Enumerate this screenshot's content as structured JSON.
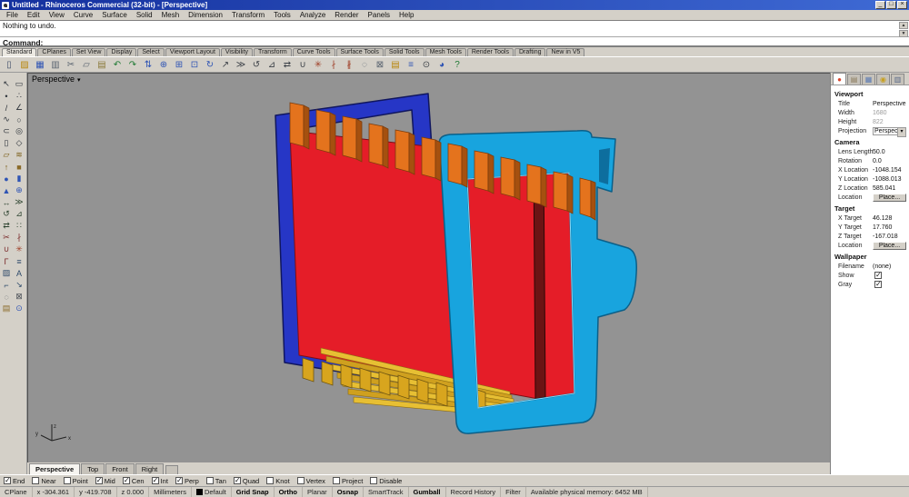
{
  "window": {
    "title": "Untitled - Rhinoceros Commercial (32-bit) - [Perspective]"
  },
  "menu": [
    "File",
    "Edit",
    "View",
    "Curve",
    "Surface",
    "Solid",
    "Mesh",
    "Dimension",
    "Transform",
    "Tools",
    "Analyze",
    "Render",
    "Panels",
    "Help"
  ],
  "command": {
    "history_line": "Nothing to undo.",
    "prompt": "Command:"
  },
  "toolbar_tabs": [
    {
      "label": "Standard",
      "active": true
    },
    {
      "label": "CPlanes"
    },
    {
      "label": "Set View"
    },
    {
      "label": "Display"
    },
    {
      "label": "Select"
    },
    {
      "label": "Viewport Layout"
    },
    {
      "label": "Visibility"
    },
    {
      "label": "Transform"
    },
    {
      "label": "Curve Tools"
    },
    {
      "label": "Surface Tools"
    },
    {
      "label": "Solid Tools"
    },
    {
      "label": "Mesh Tools"
    },
    {
      "label": "Render Tools"
    },
    {
      "label": "Drafting"
    },
    {
      "label": "New in V5"
    }
  ],
  "toolbar_icons": [
    {
      "name": "new-file-icon",
      "glyph": "▯",
      "color": "#3c4a66"
    },
    {
      "name": "open-file-icon",
      "glyph": "▨",
      "color": "#b8860b"
    },
    {
      "name": "save-file-icon",
      "glyph": "▦",
      "color": "#2f54b4"
    },
    {
      "name": "print-icon",
      "glyph": "▥",
      "color": "#5a6470"
    },
    {
      "name": "cut-icon",
      "glyph": "✂",
      "color": "#5a6470"
    },
    {
      "name": "copy-icon",
      "glyph": "▱",
      "color": "#5a6470"
    },
    {
      "name": "paste-icon",
      "glyph": "▤",
      "color": "#8a7a3a"
    },
    {
      "name": "undo-icon",
      "glyph": "↶",
      "color": "#1f7a34"
    },
    {
      "name": "redo-icon",
      "glyph": "↷",
      "color": "#1f7a34"
    },
    {
      "name": "pan-view-icon",
      "glyph": "⇅",
      "color": "#2f54b4"
    },
    {
      "name": "zoom-dynamic-icon",
      "glyph": "⊕",
      "color": "#2f54b4"
    },
    {
      "name": "zoom-window-icon",
      "glyph": "⊞",
      "color": "#2f54b4"
    },
    {
      "name": "zoom-extents-icon",
      "glyph": "⊡",
      "color": "#2f54b4"
    },
    {
      "name": "rotate-view-icon",
      "glyph": "↻",
      "color": "#2f54b4"
    },
    {
      "name": "move-icon",
      "glyph": "↗",
      "color": "#3a3f46"
    },
    {
      "name": "copy-object-icon",
      "glyph": "≫",
      "color": "#3a3f46"
    },
    {
      "name": "rotate-icon",
      "glyph": "↺",
      "color": "#3a3f46"
    },
    {
      "name": "scale-icon",
      "glyph": "⊿",
      "color": "#3a3f46"
    },
    {
      "name": "mirror-icon",
      "glyph": "⇄",
      "color": "#3a3f46"
    },
    {
      "name": "join-icon",
      "glyph": "∪",
      "color": "#3a3f46"
    },
    {
      "name": "explode-icon",
      "glyph": "✳",
      "color": "#a04028"
    },
    {
      "name": "trim-icon",
      "glyph": "∤",
      "color": "#a04028"
    },
    {
      "name": "split-icon",
      "glyph": "∦",
      "color": "#a04028"
    },
    {
      "name": "hide-icon",
      "glyph": "◌",
      "color": "#5a6470"
    },
    {
      "name": "lock-icon",
      "glyph": "⊠",
      "color": "#5a6470"
    },
    {
      "name": "layers-icon",
      "glyph": "▤",
      "color": "#b8860b"
    },
    {
      "name": "properties-icon",
      "glyph": "≡",
      "color": "#2f54b4"
    },
    {
      "name": "osnap-icon",
      "glyph": "⊙",
      "color": "#3a3f46"
    },
    {
      "name": "render-icon",
      "glyph": "◕",
      "color": "#2f54b4"
    },
    {
      "name": "help-icon",
      "glyph": "?",
      "color": "#1f7a34"
    }
  ],
  "sidebar_icons": [
    {
      "name": "select-icon",
      "glyph": "↖",
      "color": "#2b3138"
    },
    {
      "name": "select-lasso-icon",
      "glyph": "▭",
      "color": "#2b3138"
    },
    {
      "name": "point-icon",
      "glyph": "•",
      "color": "#2b3138"
    },
    {
      "name": "multi-point-icon",
      "glyph": "∴",
      "color": "#2b3138"
    },
    {
      "name": "line-icon",
      "glyph": "/",
      "color": "#2b3138"
    },
    {
      "name": "polyline-icon",
      "glyph": "∠",
      "color": "#2b3138"
    },
    {
      "name": "curve-icon",
      "glyph": "∿",
      "color": "#2b3138"
    },
    {
      "name": "circle-icon",
      "glyph": "○",
      "color": "#2b3138"
    },
    {
      "name": "arc-icon",
      "glyph": "⊂",
      "color": "#2b3138"
    },
    {
      "name": "ellipse-icon",
      "glyph": "◎",
      "color": "#2b3138"
    },
    {
      "name": "rectangle-icon",
      "glyph": "▯",
      "color": "#2b3138"
    },
    {
      "name": "polygon-icon",
      "glyph": "◇",
      "color": "#2b3138"
    },
    {
      "name": "surface-icon",
      "glyph": "▱",
      "color": "#7a5c16"
    },
    {
      "name": "loft-icon",
      "glyph": "≋",
      "color": "#7a5c16"
    },
    {
      "name": "extrude-icon",
      "glyph": "↑",
      "color": "#7a5c16"
    },
    {
      "name": "box-icon",
      "glyph": "■",
      "color": "#8a6a28"
    },
    {
      "name": "sphere-icon",
      "glyph": "●",
      "color": "#2f54b4"
    },
    {
      "name": "cylinder-icon",
      "glyph": "▮",
      "color": "#2f54b4"
    },
    {
      "name": "cone-icon",
      "glyph": "▲",
      "color": "#2f54b4"
    },
    {
      "name": "boolean-union-icon",
      "glyph": "⊕",
      "color": "#2f54b4"
    },
    {
      "name": "move-icon",
      "glyph": "↔",
      "color": "#2e4430"
    },
    {
      "name": "copy-icon",
      "glyph": "≫",
      "color": "#2e4430"
    },
    {
      "name": "rotate-icon",
      "glyph": "↺",
      "color": "#2e4430"
    },
    {
      "name": "scale-icon",
      "glyph": "⊿",
      "color": "#2e4430"
    },
    {
      "name": "mirror-icon",
      "glyph": "⇄",
      "color": "#2e4430"
    },
    {
      "name": "array-icon",
      "glyph": "∷",
      "color": "#2e4430"
    },
    {
      "name": "trim-icon",
      "glyph": "✂",
      "color": "#7a2a2a"
    },
    {
      "name": "split-icon",
      "glyph": "∤",
      "color": "#7a2a2a"
    },
    {
      "name": "join-icon",
      "glyph": "∪",
      "color": "#7a2a2a"
    },
    {
      "name": "explode-icon",
      "glyph": "✳",
      "color": "#a04028"
    },
    {
      "name": "fillet-icon",
      "glyph": "Γ",
      "color": "#7a2a2a"
    },
    {
      "name": "offset-icon",
      "glyph": "≡",
      "color": "#2e4a6a"
    },
    {
      "name": "hatch-icon",
      "glyph": "▨",
      "color": "#2e4a6a"
    },
    {
      "name": "text-icon",
      "glyph": "A",
      "color": "#2e4a6a"
    },
    {
      "name": "dimension-icon",
      "glyph": "⌐",
      "color": "#2e4a6a"
    },
    {
      "name": "leader-icon",
      "glyph": "↘",
      "color": "#2e4a6a"
    },
    {
      "name": "hide-object-icon",
      "glyph": "◌",
      "color": "#4a4f56"
    },
    {
      "name": "lock-object-icon",
      "glyph": "⊠",
      "color": "#4a4f56"
    },
    {
      "name": "layer-icon",
      "glyph": "▤",
      "color": "#8a6a28"
    },
    {
      "name": "zoom-target-icon",
      "glyph": "⊙",
      "color": "#2f54b4"
    }
  ],
  "viewport": {
    "label": "Perspective"
  },
  "viewport_tabs": [
    {
      "label": "Perspective",
      "active": true
    },
    {
      "label": "Top"
    },
    {
      "label": "Front"
    },
    {
      "label": "Right"
    }
  ],
  "properties_panel": {
    "tabs": [
      {
        "name": "tab-properties",
        "glyph": "●",
        "color": "#d9442c",
        "active": true
      },
      {
        "name": "tab-layers",
        "glyph": "▤",
        "color": "#8a7a5a"
      },
      {
        "name": "tab-display",
        "glyph": "▦",
        "color": "#5a7ab4"
      },
      {
        "name": "tab-lights",
        "glyph": "◉",
        "color": "#c8a020"
      },
      {
        "name": "tab-help",
        "glyph": "▥",
        "color": "#5a6a8a"
      }
    ],
    "sections": [
      {
        "title": "Viewport",
        "rows": [
          {
            "label": "Title",
            "value": "Perspective"
          },
          {
            "label": "Width",
            "value": "1680",
            "muted": true
          },
          {
            "label": "Height",
            "value": "822",
            "muted": true
          },
          {
            "label": "Projection",
            "value": "Perspect...",
            "dropdown": true
          }
        ]
      },
      {
        "title": "Camera",
        "rows": [
          {
            "label": "Lens Length",
            "value": "50.0"
          },
          {
            "label": "Rotation",
            "value": "0.0"
          },
          {
            "label": "X Location",
            "value": "-1048.154"
          },
          {
            "label": "Y Location",
            "value": "-1088.013"
          },
          {
            "label": "Z Location",
            "value": "585.041"
          },
          {
            "label": "Location",
            "value": "Place...",
            "button": true
          }
        ]
      },
      {
        "title": "Target",
        "rows": [
          {
            "label": "X Target",
            "value": "46.128"
          },
          {
            "label": "Y Target",
            "value": "17.760"
          },
          {
            "label": "Z Target",
            "value": "-167.018"
          },
          {
            "label": "Location",
            "value": "Place...",
            "button": true
          }
        ]
      },
      {
        "title": "Wallpaper",
        "rows": [
          {
            "label": "Filename",
            "value": "(none)"
          },
          {
            "label": "Show",
            "check": true,
            "checked": true
          },
          {
            "label": "Gray",
            "check": true,
            "checked": true
          }
        ]
      }
    ]
  },
  "osnap": {
    "items": [
      {
        "label": "End",
        "checked": true
      },
      {
        "label": "Near"
      },
      {
        "label": "Point"
      },
      {
        "label": "Mid",
        "checked": true
      },
      {
        "label": "Cen",
        "checked": true
      },
      {
        "label": "Int",
        "checked": true
      },
      {
        "label": "Perp",
        "checked": true
      },
      {
        "label": "Tan"
      },
      {
        "label": "Quad",
        "checked": true
      },
      {
        "label": "Knot"
      },
      {
        "label": "Vertex"
      },
      {
        "label": "Project"
      },
      {
        "label": "Disable"
      }
    ]
  },
  "statusbar": {
    "items": [
      {
        "label": "CPlane",
        "click": true
      },
      {
        "label": "x -304.361"
      },
      {
        "label": "y -419.708"
      },
      {
        "label": "z 0.000"
      },
      {
        "label": "Millimeters",
        "click": true
      },
      {
        "label": "Default",
        "swatch": true,
        "click": true
      },
      {
        "label": "Grid Snap",
        "bold": true,
        "click": true
      },
      {
        "label": "Ortho",
        "bold": true,
        "click": true
      },
      {
        "label": "Planar",
        "click": true
      },
      {
        "label": "Osnap",
        "bold": true,
        "click": true
      },
      {
        "label": "SmartTrack",
        "click": true
      },
      {
        "label": "Gumball",
        "bold": true,
        "click": true
      },
      {
        "label": "Record History",
        "click": true
      },
      {
        "label": "Filter",
        "click": true
      },
      {
        "label": "Available physical memory: 6452 MB"
      }
    ]
  }
}
